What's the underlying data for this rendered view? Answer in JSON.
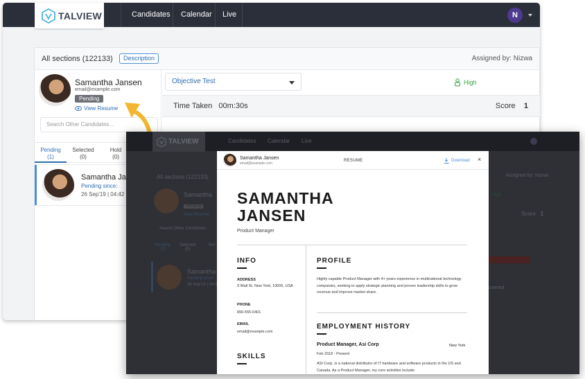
{
  "back": {
    "logo": "TALVIEW",
    "nav": [
      "Candidates",
      "Calendar",
      "Live"
    ],
    "user_initial": "N",
    "sections_title": "All sections (122133)",
    "description_button": "Description",
    "assigned_by": "Assigned by: Nizwa",
    "candidate": {
      "name": "Samantha Jansen",
      "email": "email@example.com",
      "status": "Pending",
      "view_resume": "View Resume"
    },
    "search_placeholder": "Search Other Candidates...",
    "tabs": [
      {
        "label": "Pending",
        "count": "(1)"
      },
      {
        "label": "Selected",
        "count": "(0)"
      },
      {
        "label": "Hold",
        "count": "(0)"
      }
    ],
    "list_item": {
      "name": "Samantha Jar",
      "pending_since": "Pending since:",
      "date": "26 Sep'19 | 04:42"
    },
    "test_select": "Objective Test",
    "priority": "High",
    "time_taken_label": "Time Taken",
    "time_taken_value": "00m:30s",
    "score_label": "Score",
    "score_value": "1"
  },
  "front": {
    "logo": "TALVIEW",
    "nav": [
      "Candidates",
      "Calendar",
      "Live"
    ],
    "sections_title": "All sections (122133)",
    "assigned_by": "Assigned by: Nizwa",
    "candidate_name": "Samantha",
    "pending": "Pending",
    "view_resume": "View Resume",
    "search": "Search Other Candidates",
    "tabs": [
      {
        "label": "Pending",
        "count": "(1)"
      },
      {
        "label": "Selected",
        "count": "(0)"
      },
      {
        "label": "Hol",
        "count": ""
      }
    ],
    "list_name": "Samantha",
    "list_pending": "Pending since",
    "list_date": "26 Sep'19 | 04:4",
    "high": "High",
    "score_label": "Score",
    "score_value": "1",
    "answered": "swered"
  },
  "resume": {
    "header_name": "Samantha Jansen",
    "header_email": "email@example.com",
    "title": "RESUME",
    "download": "Download",
    "close": "×",
    "name_line1": "SAMANTHA",
    "name_line2": "JANSEN",
    "job_title": "Product Manager",
    "info_heading": "INFO",
    "address_label": "ADDRESS",
    "address_value": "9 Wall St, New York, 10005, USA",
    "phone_label": "PHONE",
    "phone_value": "890-555-0401",
    "email_label": "EMAIL",
    "email_value": "email@example.com",
    "skills_heading": "SKILLS",
    "profile_heading": "PROFILE",
    "profile_text": "Highly capable Product Manager with 4+ years experience in multinational technology companies, seeking to apply strategic planning and proven leadership skills to grow revenue and improve market share.",
    "employment_heading": "EMPLOYMENT HISTORY",
    "emp_title": "Product Manager, Asi Corp",
    "emp_location": "New York",
    "emp_dates": "Feb 2018 - Present",
    "emp_text": "ASI Corp. is a national distributor of IT hardware and software products in the US and Canada. As a Product Manager, my core activities include:"
  },
  "colors": {
    "nav_bg": "#2b2f3a",
    "accent_blue": "#2e6db4",
    "arrow_yellow": "#f2b632",
    "high_green": "#2e9e3e"
  }
}
